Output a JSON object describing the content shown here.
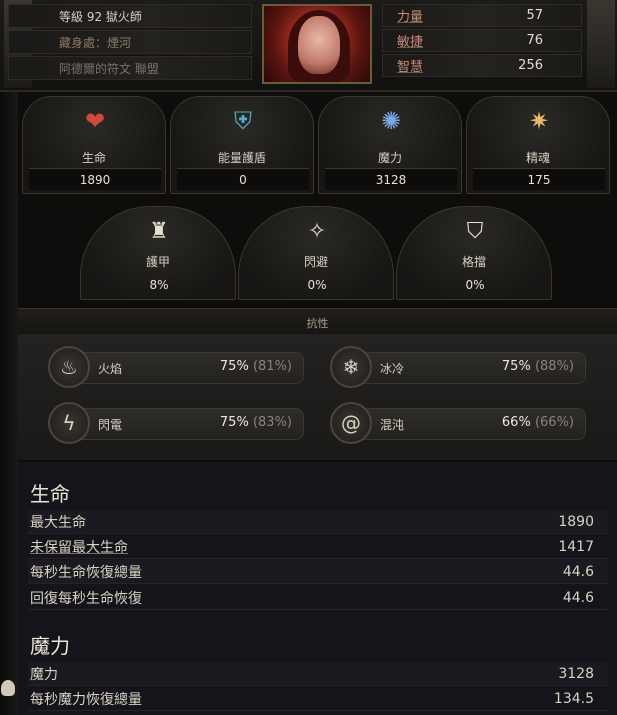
{
  "header": {
    "level_line": "等級 92 獄火師",
    "league": "藏身處：煙河",
    "rune": "阿德爾的符文 聯盟"
  },
  "attributes": [
    {
      "name": "力量",
      "value": "57"
    },
    {
      "name": "敏捷",
      "value": "76"
    },
    {
      "name": "智慧",
      "value": "256"
    }
  ],
  "panels": [
    {
      "label": "生命",
      "value": "1890",
      "icon": "heart-icon",
      "glyph": "❤",
      "color": "#d0493a"
    },
    {
      "label": "能量護盾",
      "value": "0",
      "icon": "shield-icon",
      "glyph": "⛨",
      "color": "#4fb0c8"
    },
    {
      "label": "魔力",
      "value": "3128",
      "icon": "mana-icon",
      "glyph": "✺",
      "color": "#7aa8e8"
    },
    {
      "label": "精魂",
      "value": "175",
      "icon": "spirit-icon",
      "glyph": "✷",
      "color": "#e8b870"
    }
  ],
  "defences": [
    {
      "label": "護甲",
      "value": "8%",
      "icon": "armour-icon",
      "glyph": "♜"
    },
    {
      "label": "閃避",
      "value": "0%",
      "icon": "evasion-icon",
      "glyph": "✧"
    },
    {
      "label": "格擋",
      "value": "0%",
      "icon": "block-icon",
      "glyph": "⛉"
    }
  ],
  "resistances_title": "抗性",
  "resistances": [
    {
      "name": "火焰",
      "value": "75%",
      "max": "(81%)",
      "icon": "fire-icon",
      "glyph": "♨"
    },
    {
      "name": "冰冷",
      "value": "75%",
      "max": "(88%)",
      "icon": "cold-icon",
      "glyph": "❄"
    },
    {
      "name": "閃電",
      "value": "75%",
      "max": "(83%)",
      "icon": "lightning-icon",
      "glyph": "ϟ"
    },
    {
      "name": "混沌",
      "value": "66%",
      "max": "(66%)",
      "icon": "chaos-icon",
      "glyph": "@"
    }
  ],
  "sections": [
    {
      "title": "生命",
      "rows": [
        {
          "label": "最大生命",
          "value": "1890"
        },
        {
          "label": "未保留最大生命",
          "value": "1417"
        },
        {
          "label": "每秒生命恢復總量",
          "value": "44.6"
        },
        {
          "label": "回復每秒生命恢復",
          "value": "44.6"
        }
      ]
    },
    {
      "title": "魔力",
      "rows": [
        {
          "label": "魔力",
          "value": "3128"
        },
        {
          "label": "每秒魔力恢復總量",
          "value": "134.5"
        }
      ]
    }
  ]
}
